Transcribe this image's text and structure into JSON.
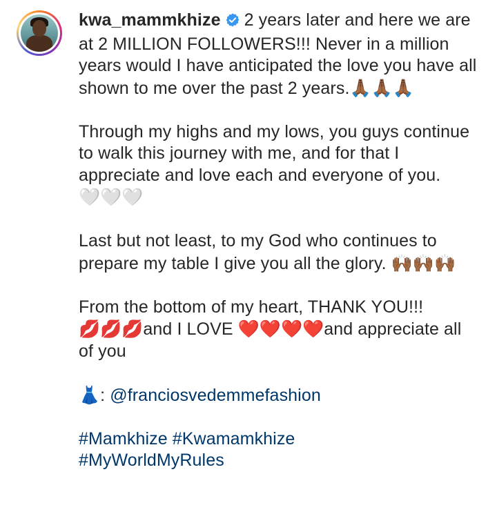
{
  "post": {
    "username": "kwa_mammkhize",
    "verified": true,
    "caption": {
      "p1_text": "2 years later and here we are at 2 MILLION FOLLOWERS!!! Never in a million years would I have anticipated the love you have all shown to me over the past 2 years.",
      "p1_emoji": "🙏🏾🙏🏾🙏🏾",
      "p2_text": "Through my highs and my lows, you guys continue to walk this journey with me, and for that I appreciate and love each and everyone of you.",
      "p2_emoji": "🤍🤍🤍",
      "p3_text": "Last but not least, to my God who continues to prepare my table I give you all the glory.",
      "p3_emoji": "🙌🏾🙌🏾🙌🏾",
      "p4_text_a": "From the bottom of my heart, THANK YOU!!!",
      "p4_emoji_a": "💋💋💋",
      "p4_text_b": "and I LOVE",
      "p4_emoji_b": "❤️❤️❤️❤️",
      "p4_text_c": "and appreciate all of you",
      "dress_emoji": "👗",
      "dress_sep": ":",
      "dress_credit": "@franciosvedemmefashion",
      "hashtags": [
        "#Mamkhize",
        "#Kwamamkhize",
        "#MyWorldMyRules"
      ]
    }
  },
  "colors": {
    "text": "#262626",
    "link": "#00376b",
    "verified_badge": "#3897f0"
  },
  "icons": {
    "verified": "verified-badge-icon"
  }
}
